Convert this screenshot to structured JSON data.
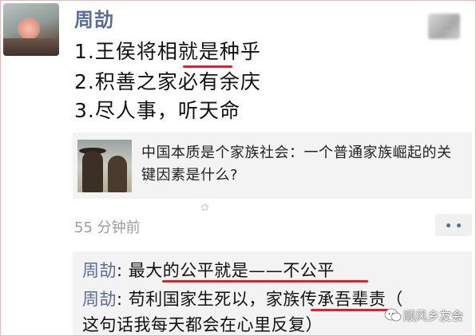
{
  "post": {
    "author": "周劼",
    "lines": [
      "1.王侯将相就是种乎",
      "2.积善之家必有余庆",
      "3.尽人事，听天命"
    ],
    "link_title": "中国本质是个家族社会：一个普通家族崛起的关键因素是什么?",
    "time": "55 分钟前"
  },
  "comments": [
    {
      "name": "周劼",
      "sep": ": ",
      "text": "最大的公平就是——不公平"
    },
    {
      "name": "周劼",
      "sep": ": ",
      "text": "苟利国家生死以，家族传承吾辈责（"
    },
    {
      "name": "",
      "sep": "",
      "text": "这句话我每天都会在心里反复）"
    }
  ],
  "watermark": "顺风乡友会",
  "colors": {
    "name_blue": "#5b6d96",
    "underline_red": "#e0202a",
    "card_bg": "#f3f3f3"
  }
}
